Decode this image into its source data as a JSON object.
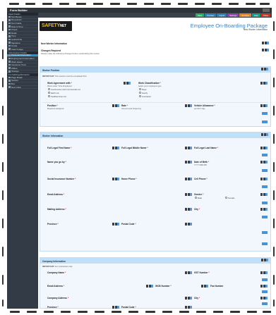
{
  "window": {
    "title": "Form Builder"
  },
  "sidebar": {
    "sections": [
      {
        "label": "Input Fields",
        "items": [
          "Text Boxes",
          "Drop-down",
          "Text Fields",
          "Date & Time",
          "Check",
          "Radio",
          "Time",
          "Upload File",
          "Signature",
          "Grade",
          "Insert Image"
        ]
      },
      {
        "label": "Information Fields",
        "items": [
          "Personal Information",
          "Employment Information",
          "Work Hours",
          "Insurance Trust",
          "Offline",
          "Storage"
        ]
      },
      {
        "label": "Formatting Elements",
        "items": [
          "Page Break",
          "Section",
          "Box",
          "Next Click"
        ]
      }
    ],
    "active_item": "Personal Information"
  },
  "toolbar": {
    "buttons": [
      {
        "label": "Save",
        "color": "#27ae60"
      },
      {
        "label": "Preview",
        "color": "#2980b9"
      },
      {
        "label": "Import",
        "color": "#2980b9"
      },
      {
        "label": "Settings",
        "color": "#8e44ad"
      },
      {
        "label": "Services",
        "color": "#e67e22"
      },
      {
        "label": "Help",
        "color": "#16a085"
      },
      {
        "label": "Close",
        "color": "#c0392b"
      }
    ]
  },
  "header": {
    "logo_main": "SAFETY",
    "logo_accent": "NET",
    "form_title": "Employee On-Boarding Package",
    "form_subtitle": "New Worker Information"
  },
  "intro": {
    "title": "New Worker Information",
    "changes_title": "Changes Required",
    "changes_hint": "Please make the following changes before resubmitting this review."
  },
  "worker_position": {
    "title": "Worker Position",
    "note_bold": "IMPORTANT:",
    "note": "This section must be completed first.",
    "agreement_label": "Work Agreement with",
    "agreement_hint": "Work under \"Hire Employee\"",
    "agreement_options": [
      "Construction and Commercial Ltd.",
      "Earth Ltd.",
      "FieldServices Ltd."
    ],
    "classification_label": "Work Classification",
    "classification_hint": "select your employee type",
    "classification_options": [
      "Days",
      "Hourly",
      "Contractor"
    ],
    "position_label": "Position",
    "position_hint": "Required assigned",
    "rate_label": "Rate",
    "rate_hint": "Amount and frequency",
    "vehicle_label": "Vehicle Allowance",
    "vehicle_hint": "per/24 h day"
  },
  "worker_information": {
    "title": "Worker Information",
    "first_name": "Full Legal First Name",
    "middle_name": "Full Legal Middle Name",
    "last_name": "Full Legal Last Name",
    "go_by": "Name you go by",
    "dob": "Date of Birth",
    "dob_hint": "YYYY-MM-DD",
    "sin": "Social Insurance Number",
    "home_phone": "Home Phone",
    "cell_phone": "Cell Phone",
    "email": "Email Address",
    "gender": "Gender",
    "gender_options": [
      "Male",
      "Female"
    ],
    "mailing": "Mailing Address",
    "city": "City",
    "province": "Province",
    "postal": "Postal Code"
  },
  "company_information": {
    "title": "Company Information",
    "note_bold": "IMPORTANT:",
    "note": "For contractors only",
    "company_name": "Company Name",
    "gst": "GST Number",
    "email": "Email Address",
    "wcb": "WCB Number",
    "fax": "Fax Number",
    "address": "Company Address",
    "city": "City",
    "province": "Province",
    "postal": "Postal Code"
  }
}
